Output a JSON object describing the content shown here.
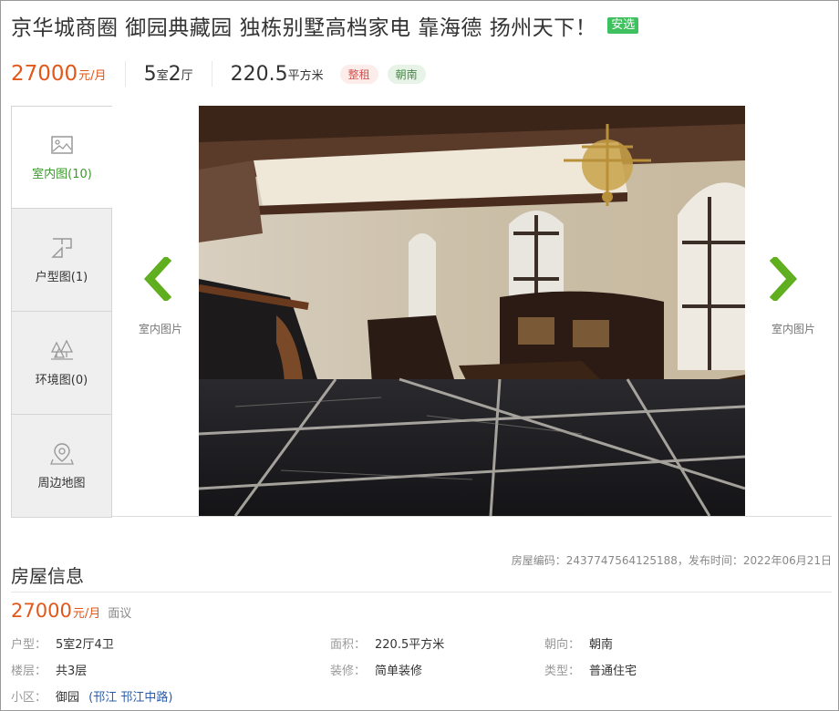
{
  "listing": {
    "title": "京华城商圈 御园典藏园 独栋别墅高档家电 靠海德 扬州天下！",
    "badge": "安选"
  },
  "summary": {
    "price": "27000",
    "price_unit": "元/月",
    "rooms_num1": "5",
    "rooms_unit1": "室",
    "rooms_num2": "2",
    "rooms_unit2": "厅",
    "area": "220.5",
    "area_unit": "平方米",
    "tag_rent": "整租",
    "tag_orient": "朝南"
  },
  "gallery": {
    "tabs": [
      {
        "label": "室内图(10)",
        "icon": "image-icon"
      },
      {
        "label": "户型图(1)",
        "icon": "floorplan-icon"
      },
      {
        "label": "环境图(0)",
        "icon": "trees-icon"
      },
      {
        "label": "周边地图",
        "icon": "map-pin-icon"
      }
    ],
    "prev_caption": "室内图片",
    "next_caption": "室内图片",
    "colors": {
      "accent_green": "#5fae1e",
      "price_orange": "#e2571a"
    }
  },
  "info": {
    "title": "房屋信息",
    "meta": "房屋编码：2437747564125188，发布时间：2022年06月21日",
    "price": "27000",
    "price_unit": "元/月",
    "negotiable": "面议",
    "fields": {
      "layout_k": "户型：",
      "layout_v": "5室2厅4卫",
      "area_k": "面积：",
      "area_v": "220.5平方米",
      "orient_k": "朝向：",
      "orient_v": "朝南",
      "floor_k": "楼层：",
      "floor_v": "共3层",
      "deco_k": "装修：",
      "deco_v": "简单装修",
      "type_k": "类型：",
      "type_v": "普通住宅",
      "community_k": "小区：",
      "community_v": "御园",
      "loc_open": "(",
      "loc_district": "邗江",
      "loc_road": "邗江中路",
      "loc_close": ")"
    }
  }
}
